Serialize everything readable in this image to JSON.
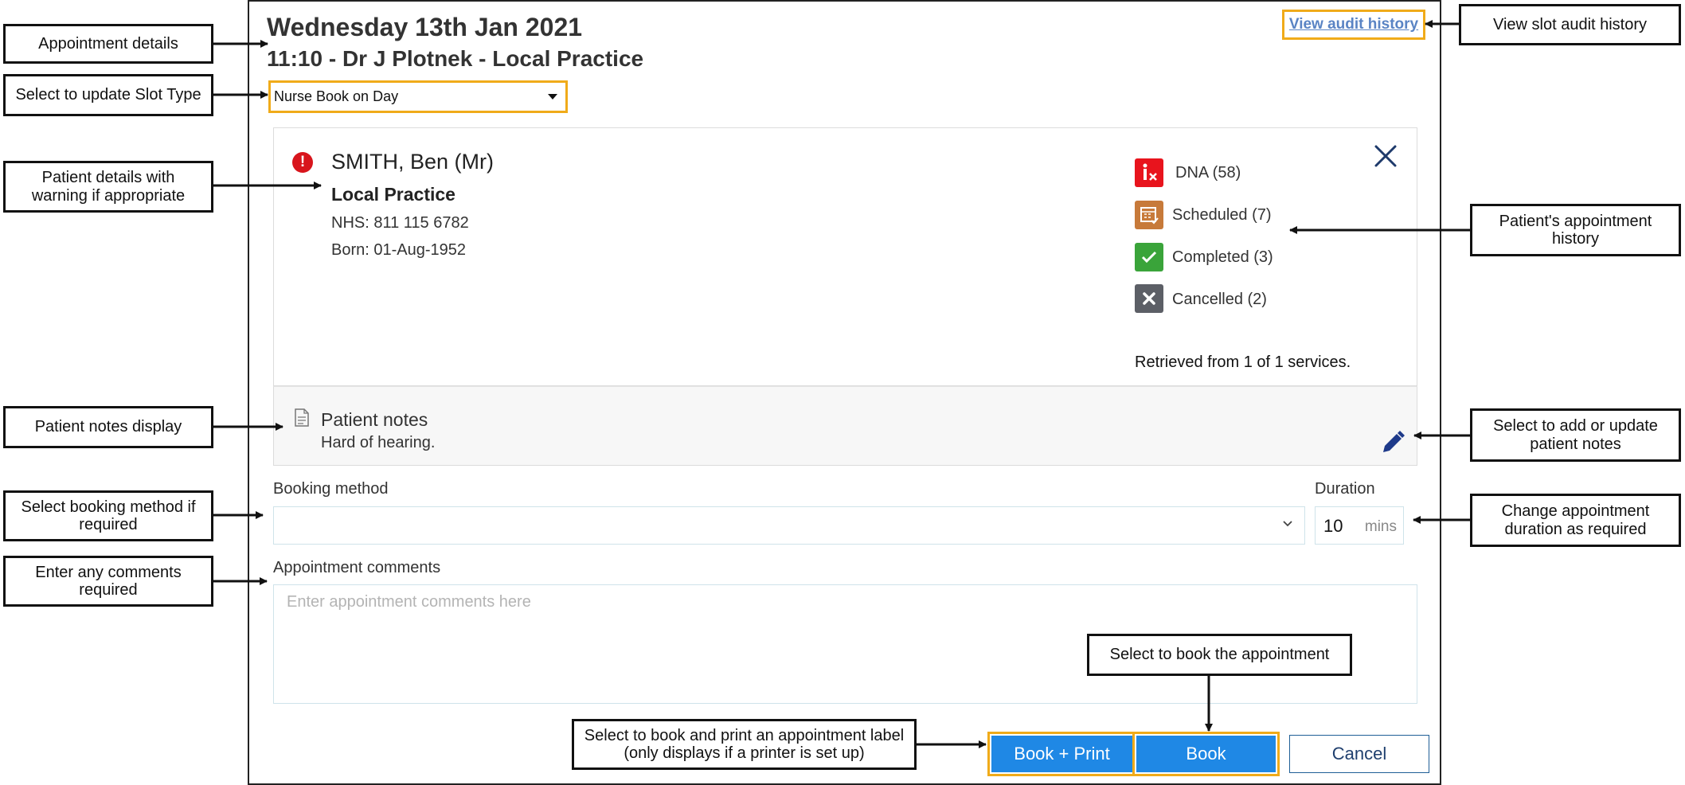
{
  "dialog": {
    "date_title": "Wednesday 13th Jan 2021",
    "slot_title": "11:10 - Dr J Plotnek - Local Practice",
    "audit_link": "View audit history",
    "slot_type": {
      "selected": "Nurse Book on Day"
    }
  },
  "patient": {
    "warning_icon": "!",
    "name": "SMITH, Ben (Mr)",
    "practice": "Local Practice",
    "nhs": "NHS: 811 115 6782",
    "born": "Born: 01-Aug-1952",
    "history": [
      {
        "label": "DNA (58)",
        "icon": "dna-icon",
        "color": "#e8141d"
      },
      {
        "label": "Scheduled (7)",
        "icon": "calendar-icon",
        "color": "#c77a3a"
      },
      {
        "label": "Completed (3)",
        "icon": "check-icon",
        "color": "#3aa43a"
      },
      {
        "label": "Cancelled (2)",
        "icon": "cross-icon",
        "color": "#5c5f66"
      }
    ],
    "retrieved": "Retrieved from 1 of 1 services."
  },
  "notes": {
    "title": "Patient notes",
    "text": "Hard of hearing."
  },
  "form": {
    "booking_method_label": "Booking method",
    "booking_method_value": "",
    "duration_label": "Duration",
    "duration_value": "10",
    "duration_unit": "mins",
    "comments_label": "Appointment comments",
    "comments_placeholder": "Enter appointment comments here"
  },
  "buttons": {
    "book_print": "Book + Print",
    "book": "Book",
    "cancel": "Cancel"
  },
  "callouts": {
    "appointment_details": "Appointment details",
    "slot_type": "Select to update Slot Type",
    "patient_details": "Patient details with warning if appropriate",
    "patient_notes": "Patient notes display",
    "booking_method": "Select booking method if required",
    "comments": "Enter any comments required",
    "audit_history": "View slot audit history",
    "appt_history": "Patient's appointment history",
    "update_notes": "Select to add or update patient notes",
    "duration": "Change appointment duration as required",
    "book": "Select to book the appointment",
    "book_print": "Select to book and print an appointment label (only displays if a printer is set up)"
  },
  "colors": {
    "accent": "#1f88e5",
    "highlight": "#f0ab1a",
    "link": "#5a84c4",
    "warning": "#d8151c"
  }
}
